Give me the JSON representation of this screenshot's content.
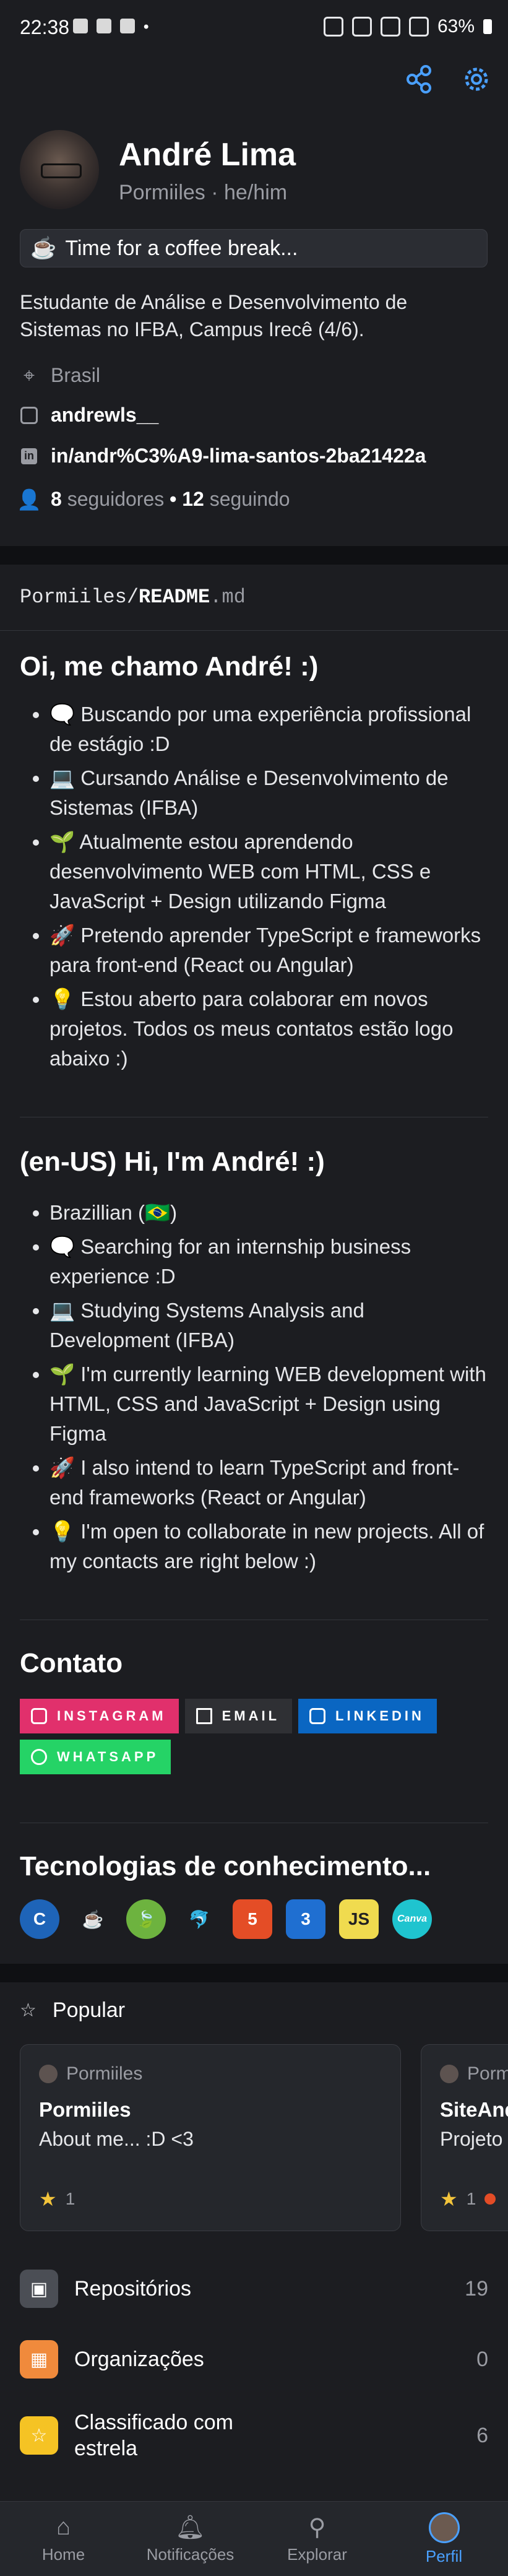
{
  "status_bar": {
    "time": "22:38",
    "battery": "63%",
    "dot": "•"
  },
  "profile": {
    "name": "André Lima",
    "handle": "Pormiiles · he/him",
    "status_emoji": "☕",
    "status_text": "Time for a coffee break...",
    "bio": "Estudante de Análise e Desenvolvimento de Sistemas no IFBA, Campus Irecê (4/6).",
    "location": "Brasil",
    "instagram": "andrewls__",
    "linkedin": "in/andr%C3%A9-lima-santos-2ba21422a",
    "followers_count": "8",
    "followers_label": "seguidores",
    "separator": "•",
    "following_count": "12",
    "following_label": "seguindo"
  },
  "readme": {
    "owner": "Pormiiles/",
    "file": "README",
    "ext": ".md",
    "heading_pt": "Oi, me chamo André! :)",
    "items_pt": [
      "🗨️ Buscando por uma experiência profissional de estágio :D",
      "💻 Cursando Análise e Desenvolvimento de Sistemas (IFBA)",
      "🌱 Atualmente estou aprendendo desenvolvimento WEB com HTML, CSS e JavaScript + Design utilizando Figma",
      "🚀 Pretendo aprender TypeScript e frameworks para front-end (React ou Angular)",
      "💡 Estou aberto para colaborar em novos projetos. Todos os meus contatos estão logo abaixo :)"
    ],
    "heading_en": "(en-US) Hi, I'm André! :)",
    "items_en": [
      "Brazillian (🇧🇷)",
      "🗨️ Searching for an internship business experience :D",
      "💻 Studying Systems Analysis and Development (IFBA)",
      "🌱 I'm currently learning WEB development with HTML, CSS and JavaScript + Design using Figma",
      "🚀 I also intend to learn TypeScript and front-end frameworks (React or Angular)",
      "💡 I'm open to collaborate in new projects. All of my contacts are right below :)"
    ],
    "contact_heading": "Contato",
    "badges": [
      {
        "label": "INSTAGRAM",
        "color": "#e1306c",
        "icon": "instagram-icon"
      },
      {
        "label": "EMAIL",
        "color": "#2f3034",
        "icon": "gmail-icon"
      },
      {
        "label": "LINKEDIN",
        "color": "#0a66c2",
        "icon": "linkedin-icon"
      },
      {
        "label": "WHATSAPP",
        "color": "#25d366",
        "icon": "whatsapp-icon"
      }
    ],
    "tech_heading": "Tecnologias de conhecimento...",
    "tech": [
      {
        "name": "c-icon",
        "glyph": "C",
        "color": "#1e64b8"
      },
      {
        "name": "java-icon",
        "glyph": "☕",
        "color": "#1c1d21"
      },
      {
        "name": "spring-icon",
        "glyph": "🍃",
        "color": "#6db33f"
      },
      {
        "name": "mysql-icon",
        "glyph": "🐬",
        "color": "#1c1d21"
      },
      {
        "name": "html5-icon",
        "glyph": "5",
        "color": "#e44d26"
      },
      {
        "name": "css3-icon",
        "glyph": "3",
        "color": "#1f6fd1"
      },
      {
        "name": "javascript-icon",
        "glyph": "JS",
        "color": "#f0db4f"
      },
      {
        "name": "canva-icon",
        "glyph": "Canva",
        "color": "#1fc4cf"
      }
    ]
  },
  "popular": {
    "title": "Popular",
    "cards": [
      {
        "owner": "Pormiiles",
        "repo": "Pormiiles",
        "desc": "About me... :D <3",
        "stars": "1"
      },
      {
        "owner": "Porm",
        "repo": "SiteAnd",
        "desc": "Projeto",
        "stars": "1"
      }
    ]
  },
  "menu": [
    {
      "label": "Repositórios",
      "count": "19",
      "color": "#4b4e55",
      "icon": "repo-icon"
    },
    {
      "label": "Organizações",
      "count": "0",
      "color": "#f08a3c",
      "icon": "organization-icon"
    },
    {
      "label": "Classificado com estrela",
      "count": "6",
      "color": "#f5c324",
      "icon": "star-icon"
    }
  ],
  "nav": [
    {
      "label": "Home",
      "icon": "home-icon"
    },
    {
      "label": "Notificações",
      "icon": "bell-icon"
    },
    {
      "label": "Explorar",
      "icon": "telescope-icon"
    },
    {
      "label": "Perfil",
      "icon": "avatar"
    }
  ]
}
